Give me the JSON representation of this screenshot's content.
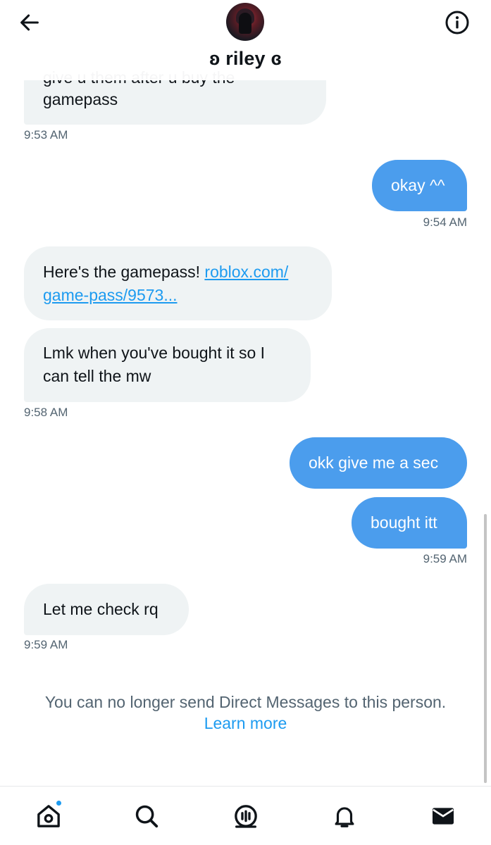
{
  "header": {
    "name": "ʚ riley ɞ"
  },
  "messages": [
    {
      "side": "in",
      "text_top_fragment": "give u them after u buy the",
      "text": "gamepass",
      "time": "9:53 AM"
    },
    {
      "side": "out",
      "text": "okay ^^",
      "time": "9:54 AM"
    },
    {
      "side": "in",
      "text_prefix": "Here's the gamepass!",
      "link_line1": "roblox.com/",
      "link_line2": "game-pass/9573..."
    },
    {
      "side": "in",
      "line1": "Lmk when you've bought it so I",
      "line2": "can tell the mw",
      "time": "9:58 AM"
    },
    {
      "side": "out",
      "text": "okk give me a sec"
    },
    {
      "side": "out",
      "text": "bought itt",
      "time": "9:59 AM"
    },
    {
      "side": "in",
      "text": "Let me check rq",
      "time": "9:59 AM"
    }
  ],
  "notice": {
    "text": "You can no longer send Direct Messages to this person.",
    "link": "Learn more"
  },
  "nav": {
    "items": [
      "home-icon",
      "search-icon",
      "spaces-icon",
      "notifications-icon",
      "messages-icon"
    ],
    "accent": "#1d9bf0"
  },
  "colors": {
    "incoming_bubble": "#eff3f4",
    "outgoing_bubble": "#4b9ded",
    "timestamp": "#536471",
    "link": "#1d9bf0"
  }
}
